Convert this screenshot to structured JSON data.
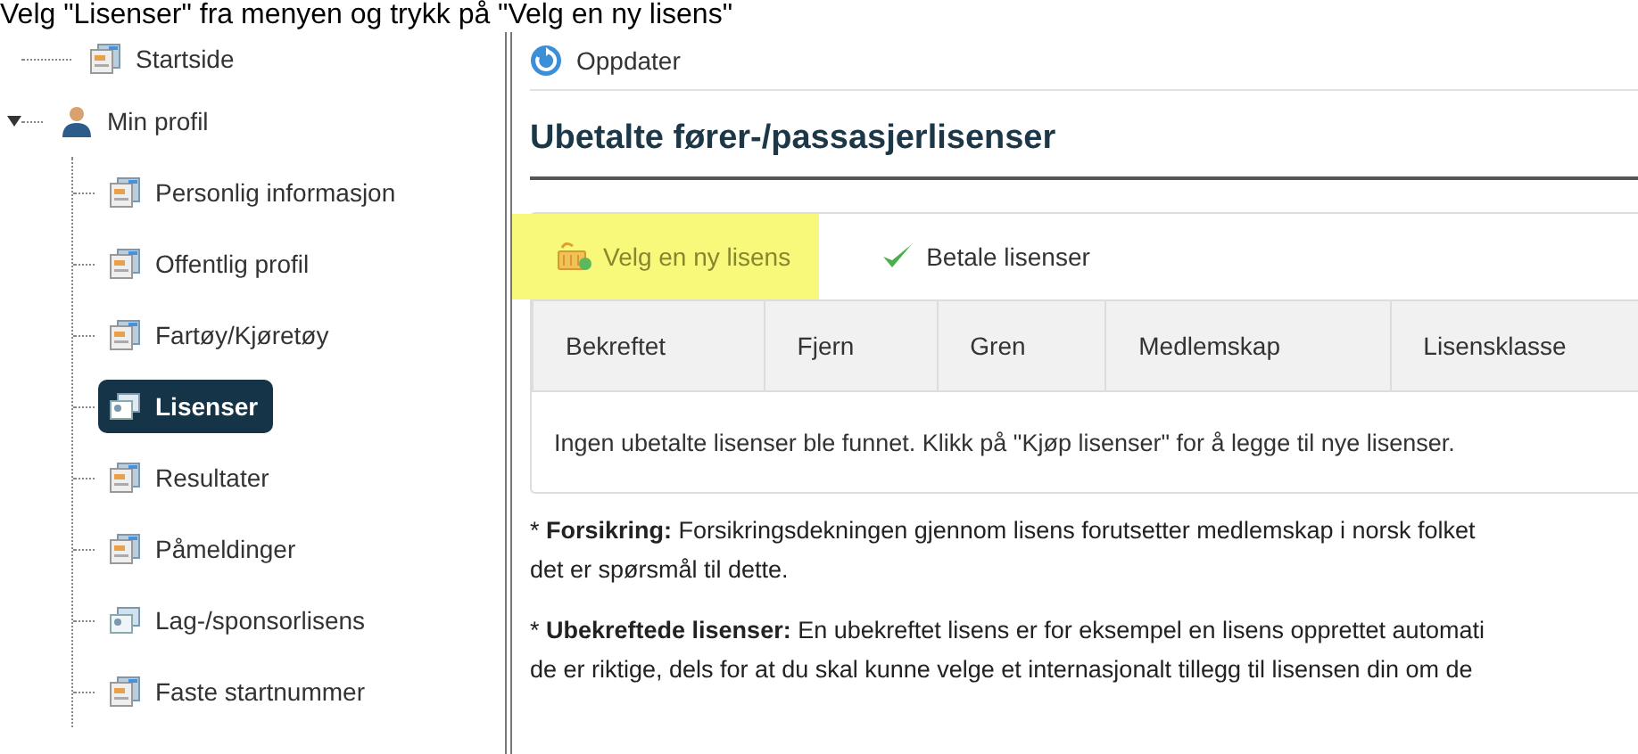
{
  "caption": "Velg \"Lisenser\" fra menyen og trykk på \"Velg en ny lisens\"",
  "sidebar": {
    "items": [
      {
        "label": "Startside",
        "kind": "page",
        "selected": false
      },
      {
        "label": "Min profil",
        "kind": "person",
        "selected": false,
        "expanded": true,
        "children": [
          {
            "label": "Personlig informasjon",
            "kind": "page",
            "selected": false
          },
          {
            "label": "Offentlig profil",
            "kind": "page",
            "selected": false
          },
          {
            "label": "Fartøy/Kjøretøy",
            "kind": "page",
            "selected": false
          },
          {
            "label": "Lisenser",
            "kind": "group",
            "selected": true
          },
          {
            "label": "Resultater",
            "kind": "page",
            "selected": false
          },
          {
            "label": "Påmeldinger",
            "kind": "page",
            "selected": false
          },
          {
            "label": "Lag-/sponsorlisens",
            "kind": "group",
            "selected": false
          },
          {
            "label": "Faste startnummer",
            "kind": "page",
            "selected": false
          }
        ]
      }
    ]
  },
  "toolbar": {
    "refresh_button": "Oppdater"
  },
  "heading": "Ubetalte fører-/passasjerlisenser",
  "actions": [
    {
      "label": "Velg en ny lisens",
      "kind": "basket",
      "highlighted": true
    },
    {
      "label": "Betale lisenser",
      "kind": "check",
      "highlighted": false
    }
  ],
  "table": {
    "columns": [
      "Bekreftet",
      "Fjern",
      "Gren",
      "Medlemskap",
      "Lisensklasse"
    ],
    "empty_message": "Ingen ubetalte lisenser ble funnet. Klikk på \"Kjøp lisenser\" for å legge til nye lisenser."
  },
  "notes": [
    {
      "lines": [
        "* **Forsikring:** Forsikringsdekningen gjennom lisens forutsetter medlemskap i norsk folket",
        "det er spørsmål til dette."
      ]
    },
    {
      "lines": [
        "* **Ubekreftede lisenser:** En ubekreftet lisens er for eksempel en lisens opprettet automati",
        "de er riktige, dels for at du skal kunne velge et internasjonalt tillegg til lisensen din om de"
      ]
    }
  ]
}
